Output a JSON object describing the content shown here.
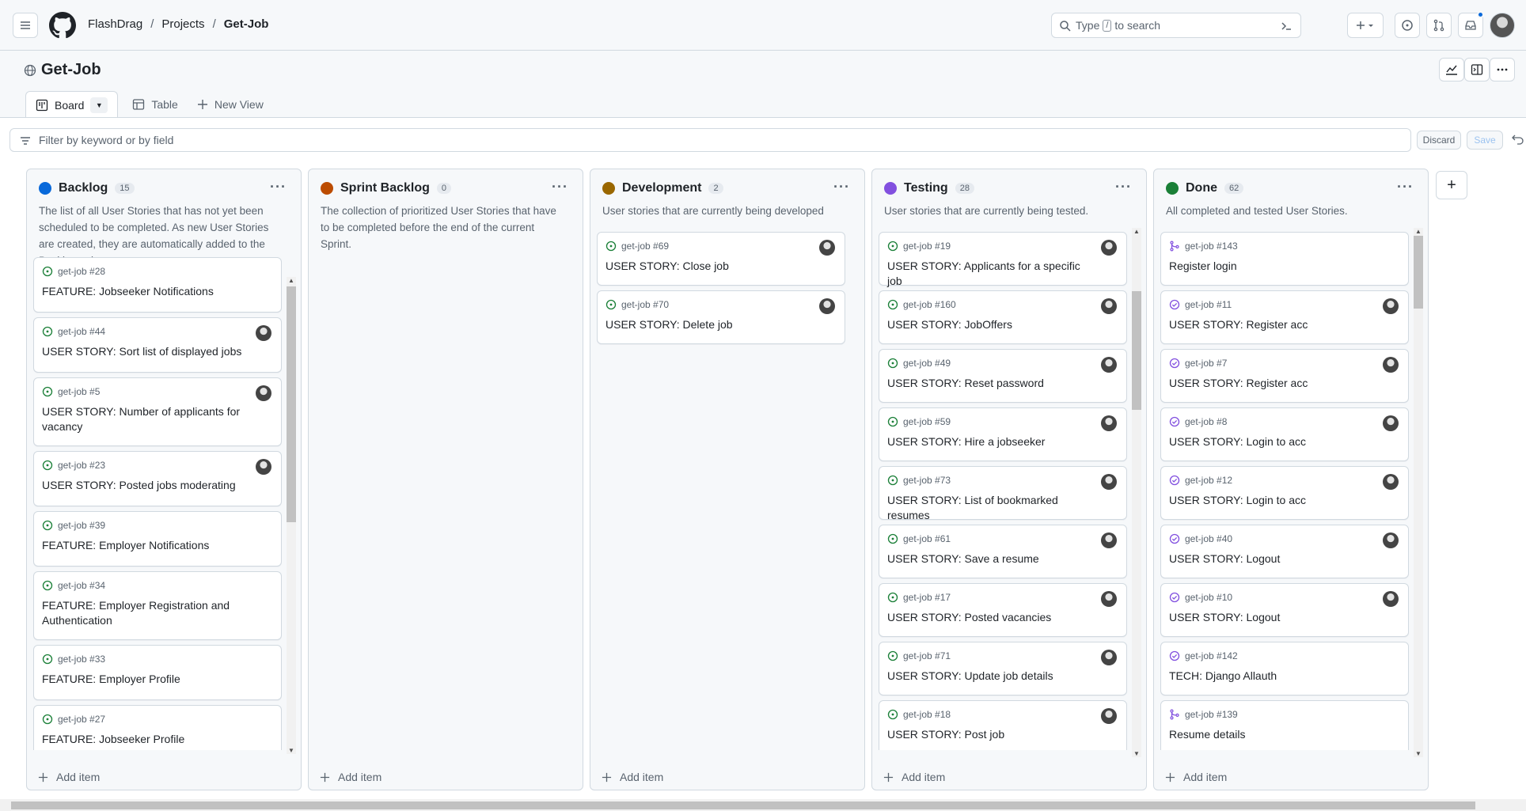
{
  "header": {
    "breadcrumb": [
      "FlashDrag",
      "Projects",
      "Get-Job"
    ],
    "search_pre": "Type",
    "search_key": "/",
    "search_post": "to search"
  },
  "project": {
    "title": "Get-Job",
    "tabs": [
      {
        "label": "Board"
      },
      {
        "label": "Table"
      },
      {
        "label": "New View"
      }
    ],
    "filter_placeholder": "Filter by keyword or by field",
    "discard_label": "Discard",
    "save_label": "Save"
  },
  "colors": {
    "open_issue": "#1a7f37",
    "closed_issue": "#8250df",
    "backlog": "#0969da",
    "sprint": "#bc4c00",
    "development": "#9a6700",
    "testing": "#8250df",
    "done": "#1a7f37"
  },
  "columns": [
    {
      "name": "Backlog",
      "count": "15",
      "color": "#0969da",
      "description": "The list of all User Stories that has not yet been scheduled to be completed. As new User Stories are created, they are automatically added to the Backlog column",
      "add_label": "Add item",
      "cards": [
        {
          "ref": "get-job #28",
          "title": "FEATURE: Jobseeker Notifications",
          "icon": "open-issue",
          "avatar": false
        },
        {
          "ref": "get-job #44",
          "title": "USER STORY: Sort list of displayed jobs",
          "icon": "open-issue",
          "avatar": true
        },
        {
          "ref": "get-job #5",
          "title": "USER STORY: Number of applicants for vacancy",
          "icon": "open-issue",
          "avatar": true
        },
        {
          "ref": "get-job #23",
          "title": "USER STORY: Posted jobs moderating",
          "icon": "open-issue",
          "avatar": true
        },
        {
          "ref": "get-job #39",
          "title": "FEATURE: Employer Notifications",
          "icon": "open-issue",
          "avatar": false
        },
        {
          "ref": "get-job #34",
          "title": "FEATURE: Employer Registration and Authentication",
          "icon": "open-issue",
          "avatar": false
        },
        {
          "ref": "get-job #33",
          "title": "FEATURE: Employer Profile",
          "icon": "open-issue",
          "avatar": false
        },
        {
          "ref": "get-job #27",
          "title": "FEATURE: Jobseeker Profile",
          "icon": "open-issue",
          "avatar": false
        }
      ]
    },
    {
      "name": "Sprint Backlog",
      "count": "0",
      "color": "#bc4c00",
      "description": "The collection of prioritized User Stories that have to be completed before the end of the current Sprint.",
      "add_label": "Add item",
      "cards": []
    },
    {
      "name": "Development",
      "count": "2",
      "color": "#9a6700",
      "description": "User stories that are currently being developed",
      "add_label": "Add item",
      "cards": [
        {
          "ref": "get-job #69",
          "title": "USER STORY: Close job",
          "icon": "open-issue",
          "avatar": true
        },
        {
          "ref": "get-job #70",
          "title": "USER STORY: Delete job",
          "icon": "open-issue",
          "avatar": true
        }
      ]
    },
    {
      "name": "Testing",
      "count": "28",
      "color": "#8250df",
      "description": "User stories that are currently being tested.",
      "add_label": "Add item",
      "cards": [
        {
          "ref": "get-job #19",
          "title": "USER STORY: Applicants for a specific job",
          "icon": "open-issue",
          "avatar": true
        },
        {
          "ref": "get-job #160",
          "title": "USER STORY: JobOffers",
          "icon": "open-issue",
          "avatar": true
        },
        {
          "ref": "get-job #49",
          "title": "USER STORY: Reset password",
          "icon": "open-issue",
          "avatar": true
        },
        {
          "ref": "get-job #59",
          "title": "USER STORY: Hire a jobseeker",
          "icon": "open-issue",
          "avatar": true
        },
        {
          "ref": "get-job #73",
          "title": "USER STORY: List of bookmarked resumes",
          "icon": "open-issue",
          "avatar": true
        },
        {
          "ref": "get-job #61",
          "title": "USER STORY: Save a resume",
          "icon": "open-issue",
          "avatar": true
        },
        {
          "ref": "get-job #17",
          "title": "USER STORY: Posted vacancies",
          "icon": "open-issue",
          "avatar": true
        },
        {
          "ref": "get-job #71",
          "title": "USER STORY: Update job details",
          "icon": "open-issue",
          "avatar": true
        },
        {
          "ref": "get-job #18",
          "title": "USER STORY: Post job",
          "icon": "open-issue",
          "avatar": true
        }
      ]
    },
    {
      "name": "Done",
      "count": "62",
      "color": "#1a7f37",
      "description": "All completed and tested User Stories.",
      "add_label": "Add item",
      "cards": [
        {
          "ref": "get-job #143",
          "title": "Register login",
          "icon": "merged-pr",
          "avatar": false
        },
        {
          "ref": "get-job #11",
          "title": "USER STORY: Register acc",
          "icon": "closed-issue",
          "avatar": true
        },
        {
          "ref": "get-job #7",
          "title": "USER STORY: Register acc",
          "icon": "closed-issue",
          "avatar": true
        },
        {
          "ref": "get-job #8",
          "title": "USER STORY: Login to acc",
          "icon": "closed-issue",
          "avatar": true
        },
        {
          "ref": "get-job #12",
          "title": "USER STORY: Login to acc",
          "icon": "closed-issue",
          "avatar": true
        },
        {
          "ref": "get-job #40",
          "title": "USER STORY: Logout",
          "icon": "closed-issue",
          "avatar": true
        },
        {
          "ref": "get-job #10",
          "title": "USER STORY: Logout",
          "icon": "closed-issue",
          "avatar": true
        },
        {
          "ref": "get-job #142",
          "title": "TECH: Django Allauth",
          "icon": "closed-issue",
          "avatar": false
        },
        {
          "ref": "get-job #139",
          "title": "Resume details",
          "icon": "merged-pr",
          "avatar": false
        }
      ]
    }
  ]
}
